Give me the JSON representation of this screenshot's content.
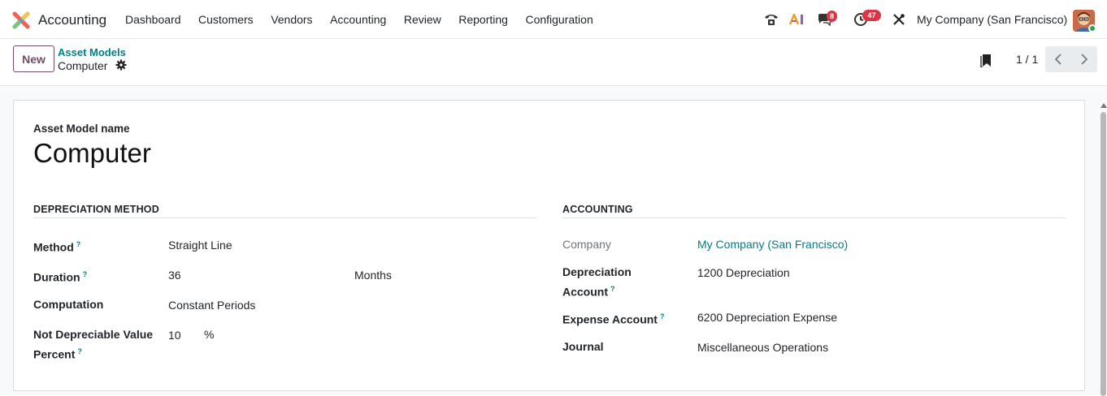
{
  "topbar": {
    "app_name": "Accounting",
    "menu": [
      "Dashboard",
      "Customers",
      "Vendors",
      "Accounting",
      "Review",
      "Reporting",
      "Configuration"
    ],
    "messages_count": "8",
    "activities_count": "47",
    "company": "My Company (San Francisco)",
    "icons": [
      "phone-icon",
      "ai-icon",
      "chat-icon",
      "clock-icon",
      "tools-icon"
    ]
  },
  "control": {
    "new_label": "New",
    "breadcrumb_parent": "Asset Models",
    "breadcrumb_current": "Computer",
    "pager": "1 / 1"
  },
  "form": {
    "name_label": "Asset Model name",
    "name_value": "Computer",
    "depreciation": {
      "title": "DEPRECIATION METHOD",
      "method_label": "Method",
      "method_value": "Straight Line",
      "duration_label": "Duration",
      "duration_value": "36",
      "duration_unit": "Months",
      "computation_label": "Computation",
      "computation_value": "Constant Periods",
      "ndv_label_line1": "Not Depreciable Value",
      "ndv_label_line2": "Percent",
      "ndv_value": "10",
      "ndv_unit": "%"
    },
    "accounting": {
      "title": "ACCOUNTING",
      "company_label": "Company",
      "company_value": "My Company (San Francisco)",
      "dep_account_label_line1": "Depreciation",
      "dep_account_label_line2": "Account",
      "dep_account_value": "1200 Depreciation",
      "expense_label": "Expense Account",
      "expense_value": "6200 Depreciation Expense",
      "journal_label": "Journal",
      "journal_value": "Miscellaneous Operations"
    }
  },
  "colors": {
    "brand": "#714b67",
    "link": "#017e84",
    "badge": "#dc3545"
  }
}
